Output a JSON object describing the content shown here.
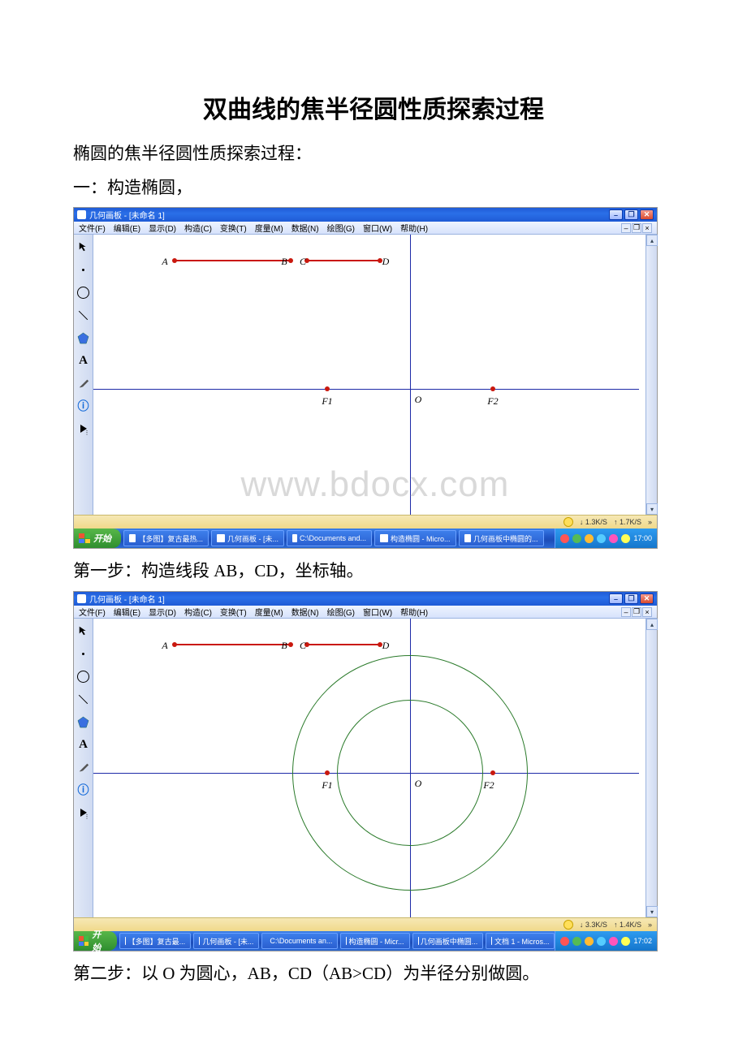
{
  "doc": {
    "title": "双曲线的焦半径圆性质探索过程",
    "intro": "椭圆的焦半径圆性质探索过程：",
    "section1": "一：构造椭圆，",
    "step1": "第一步：构造线段 AB，CD，坐标轴。",
    "step2": "第二步：以 O 为圆心，AB，CD（AB>CD）为半径分别做圆。",
    "watermark": "www.bdocx.com"
  },
  "app": {
    "title": "几何画板 - [未命名 1]",
    "menus": [
      "文件(F)",
      "编辑(E)",
      "显示(D)",
      "构造(C)",
      "变换(T)",
      "度量(M)",
      "数据(N)",
      "绘图(G)",
      "窗口(W)",
      "帮助(H)"
    ],
    "win_controls": {
      "min": "–",
      "max": "❐",
      "close": "✕"
    },
    "doc_controls": {
      "min": "–",
      "max": "❐",
      "close": "×"
    },
    "status1a": "1.3K/S",
    "status1b": "1.7K/S",
    "status2a": "3.3K/S",
    "status2b": "1.4K/S",
    "taskbar_start": "开始",
    "task_items1": [
      "【多图】复古最热...",
      "几何画板 - [未...",
      "C:\\Documents and...",
      "构造椭圆 - Micro...",
      "几何画板中椭圆的..."
    ],
    "task_items2": [
      "【多图】复古最...",
      "几何画板 - [未...",
      "C:\\Documents an...",
      "构造椭圆 - Micr...",
      "几何画板中椭圆...",
      "文档 1 - Micros..."
    ],
    "time1": "17:00",
    "time2": "17:02"
  },
  "labels": {
    "A": "A",
    "B": "B",
    "C": "C",
    "D": "D",
    "F1": "F1",
    "F2": "F2",
    "O": "O"
  }
}
